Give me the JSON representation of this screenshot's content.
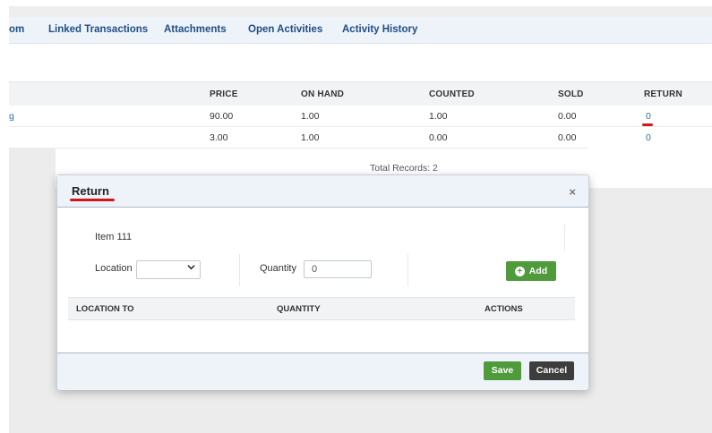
{
  "tabs": [
    "om",
    "Linked Transactions",
    "Attachments",
    "Open Activities",
    "Activity History"
  ],
  "grid": {
    "columns": [
      "PRICE",
      "ON HAND",
      "COUNTED",
      "SOLD",
      "RETURN"
    ],
    "rows": [
      {
        "name": "g",
        "price": "90.00",
        "on_hand": "1.00",
        "counted": "1.00",
        "sold": "0.00",
        "return": "0"
      },
      {
        "name": "",
        "price": "3.00",
        "on_hand": "1.00",
        "counted": "0.00",
        "sold": "0.00",
        "return": "0"
      }
    ],
    "total_records": "Total Records: 2"
  },
  "modal": {
    "title": "Return",
    "close": "×",
    "item_label": "Item  111",
    "location_label": "Location",
    "location_value": "",
    "quantity_label": "Quantity",
    "quantity_value": "0",
    "add_label": "Add",
    "table_columns": [
      "LOCATION TO",
      "QUANTITY",
      "ACTIONS"
    ],
    "save_label": "Save",
    "cancel_label": "Cancel"
  },
  "colors": {
    "accent_green": "#4f9a3b",
    "link_blue": "#2a6db0",
    "annotation_red": "#d01818"
  }
}
